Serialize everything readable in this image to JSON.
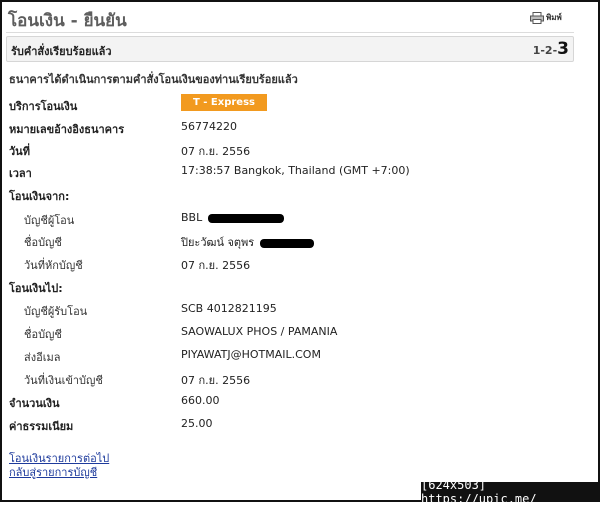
{
  "page": {
    "title": "โอนเงิน - ยืนยัน",
    "print_label": "พิมพ์",
    "status_text": "รับคำสั่งเรียบร้อยแล้ว",
    "steps": {
      "step1": "1",
      "step2": "2",
      "step3": "3",
      "sep": "-"
    },
    "intro": "ธนาคารได้ดำเนินการตามคำสั่งโอนเงินของท่านเรียบร้อยแล้ว"
  },
  "details": {
    "service": {
      "label": "บริการโอนเงิน",
      "value": "T - Express"
    },
    "reference": {
      "label": "หมายเลขอ้างอิงธนาคาร",
      "value": "56774220"
    },
    "date": {
      "label": "วันที่",
      "value": "07 ก.ย. 2556"
    },
    "time": {
      "label": "เวลา",
      "value": "17:38:57 Bangkok, Thailand (GMT +7:00)"
    },
    "from": {
      "heading": "โอนเงินจาก:",
      "account_label": "บัญชีผู้โอน",
      "account_value": "BBL",
      "name_label": "ชื่อบัญชี",
      "name_value": "ปิยะวัฒน์ จตุพร",
      "debit_date_label": "วันที่หักบัญชี",
      "debit_date_value": "07 ก.ย. 2556"
    },
    "to": {
      "heading": "โอนเงินไป:",
      "account_label": "บัญชีผู้รับโอน",
      "account_value": "SCB 4012821195",
      "name_label": "ชื่อบัญชี",
      "name_value": "SAOWALUX PHOS / PAMANIA",
      "email_label": "ส่งอีเมล",
      "email_value": "PIYAWATJ@HOTMAIL.COM",
      "credit_date_label": "วันที่เงินเข้าบัญชี",
      "credit_date_value": "07 ก.ย. 2556"
    },
    "amount": {
      "label": "จำนวนเงิน",
      "value": "660.00"
    },
    "fee": {
      "label": "ค่าธรรมเนียม",
      "value": "25.00"
    }
  },
  "links": {
    "next_transfer": "โอนเงินรายการต่อไป",
    "back_to_accounts": "กลับสู่รายการบัญชี"
  },
  "watermark": "[624x503] https://upic.me/",
  "colors": {
    "badge": "#f29a1f",
    "link": "#1d3a9c"
  }
}
